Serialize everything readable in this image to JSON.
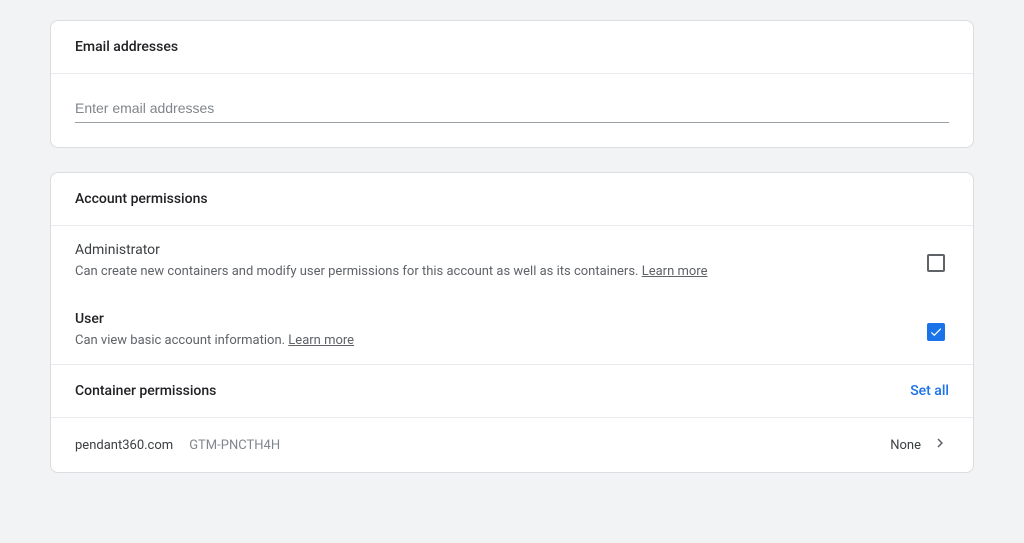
{
  "email_section": {
    "header": "Email addresses",
    "placeholder": "Enter email addresses"
  },
  "account_permissions": {
    "header": "Account permissions",
    "roles": [
      {
        "title": "Administrator",
        "desc": "Can create new containers and modify user permissions for this account as well as its containers.",
        "learn_more": "Learn more",
        "checked": false,
        "strong": false
      },
      {
        "title": "User",
        "desc": "Can view basic account information.",
        "learn_more": "Learn more",
        "checked": true,
        "strong": true
      }
    ]
  },
  "container_permissions": {
    "header": "Container permissions",
    "set_all": "Set all",
    "containers": [
      {
        "name": "pendant360.com",
        "id": "GTM-PNCTH4H",
        "permission": "None"
      }
    ]
  }
}
